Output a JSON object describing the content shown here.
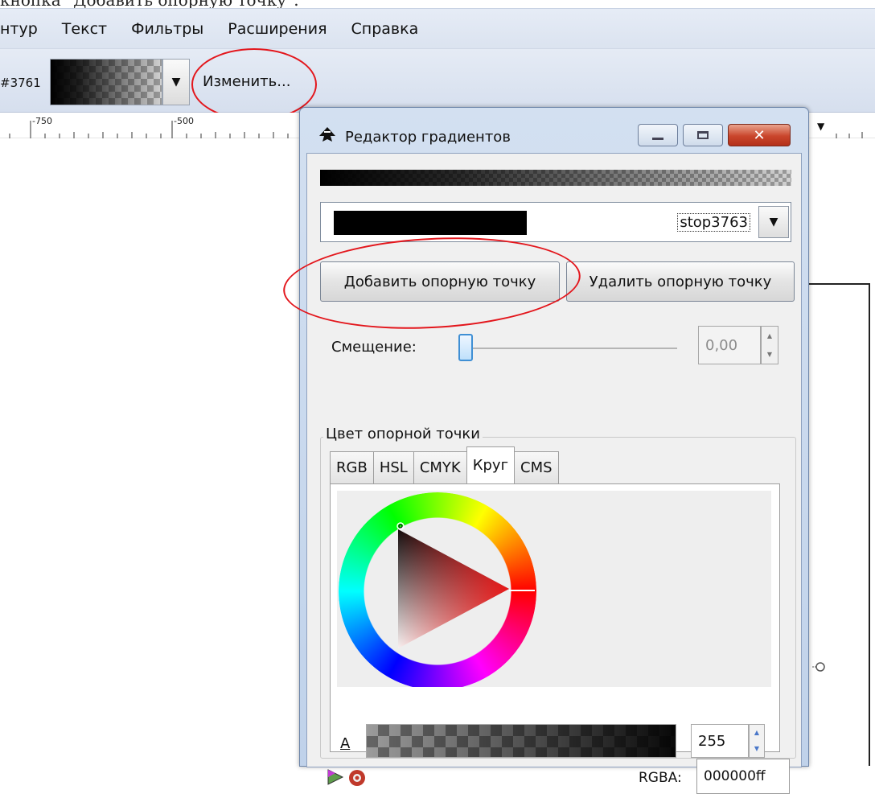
{
  "caption": "кнопка \"Добавить опорную точку\".",
  "menubar": {
    "items": [
      {
        "label": "нтур"
      },
      {
        "label": "Текст"
      },
      {
        "label": "Фильтры"
      },
      {
        "label": "Расширения"
      },
      {
        "label": "Справка"
      }
    ]
  },
  "toolbar": {
    "gradient_id": "#3761",
    "edit_label": "Изменить..."
  },
  "ruler": {
    "ticks": [
      "-750",
      "-500"
    ]
  },
  "dialog": {
    "title": "Редактор градиентов",
    "stop_name": "stop3763",
    "add_stop_label": "Добавить опорную точку",
    "delete_stop_label": "Удалить опорную точку",
    "offset_label": "Смещение:",
    "offset_value": "0,00",
    "group_label": "Цвет опорной точки",
    "tabs": [
      {
        "label": "RGB"
      },
      {
        "label": "HSL"
      },
      {
        "label": "CMYK"
      },
      {
        "label": "Круг"
      },
      {
        "label": "CMS"
      }
    ],
    "active_tab": "Круг",
    "alpha_label": "A",
    "alpha_value": "255",
    "rgba_label": "RGBA:",
    "rgba_value": "000000ff"
  },
  "colors": {
    "highlight_ellipse": "#e3161c",
    "close_button": "#c9452b",
    "stop_color": "#000000"
  }
}
